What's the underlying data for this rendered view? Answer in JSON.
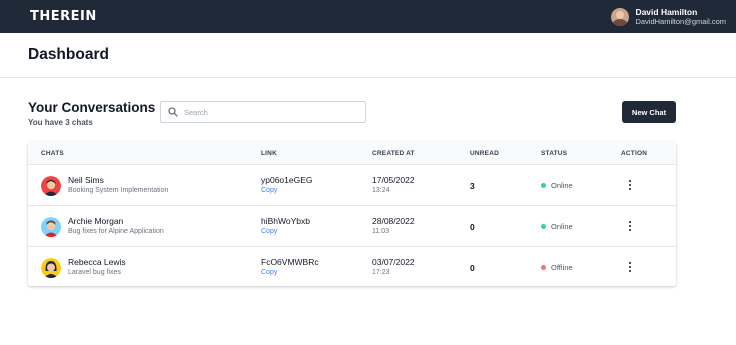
{
  "app": {
    "logo": "THEREIN"
  },
  "user": {
    "name": "David Hamilton",
    "email": "DavidHamilton@gmail.com"
  },
  "page": {
    "title": "Dashboard"
  },
  "conversations": {
    "title": "Your Conversations",
    "subtitle": "You have 3 chats",
    "search_placeholder": "Search",
    "new_chat_label": "New Chat"
  },
  "table": {
    "headers": [
      "CHATS",
      "LINK",
      "CREATED AT",
      "UNREAD",
      "STATUS",
      "ACTION"
    ],
    "rows": [
      {
        "name": "Neil Sims",
        "description": "Booking System Implementation",
        "link": "yp06o1eGEG",
        "copy": "Copy",
        "date": "17/05/2022",
        "time": "13:24",
        "unread": "3",
        "status": "Online",
        "status_color": "#34d399",
        "avatar_bg": "#ef4444"
      },
      {
        "name": "Archie Morgan",
        "description": "Bug fixes for Alpine Application",
        "link": "hiBhWoYbxb",
        "copy": "Copy",
        "date": "28/08/2022",
        "time": "11:03",
        "unread": "0",
        "status": "Online",
        "status_color": "#34d399",
        "avatar_bg": "#7dd3fc"
      },
      {
        "name": "Rebecca Lewis",
        "description": "Laravel bug fixes",
        "link": "FcO6VMWBRc",
        "copy": "Copy",
        "date": "03/07/2022",
        "time": "17:23",
        "unread": "0",
        "status": "Offline",
        "status_color": "#f87171",
        "avatar_bg": "#facc15"
      }
    ]
  },
  "colors": {
    "topbar": "#1f2937",
    "accent_link": "#3b82f6",
    "online": "#34d399",
    "offline": "#f87171"
  }
}
